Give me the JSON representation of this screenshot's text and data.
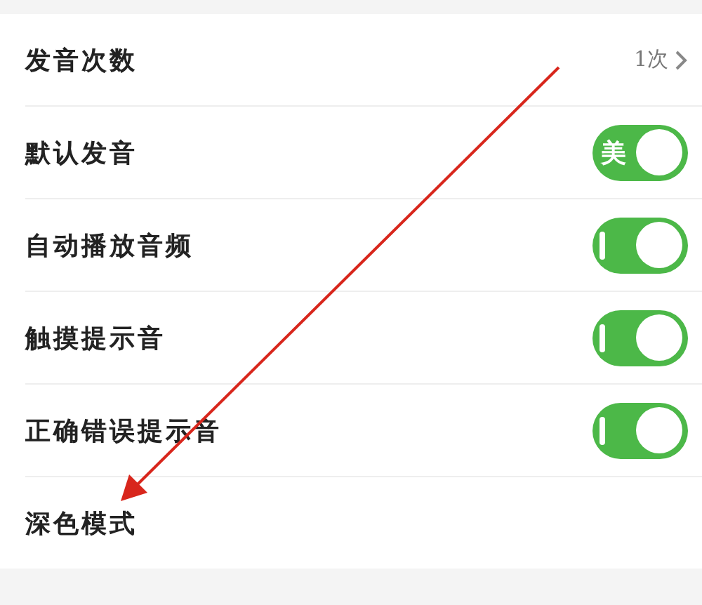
{
  "settings": [
    {
      "kind": "value",
      "label": "发音次数",
      "value": "1次"
    },
    {
      "kind": "toggle",
      "label": "默认发音",
      "on": true,
      "toggle_label": "美"
    },
    {
      "kind": "toggle",
      "label": "自动播放音频",
      "on": true
    },
    {
      "kind": "toggle",
      "label": "触摸提示音",
      "on": true
    },
    {
      "kind": "toggle",
      "label": "正确错误提示音",
      "on": true
    },
    {
      "kind": "plain",
      "label": "深色模式"
    }
  ]
}
